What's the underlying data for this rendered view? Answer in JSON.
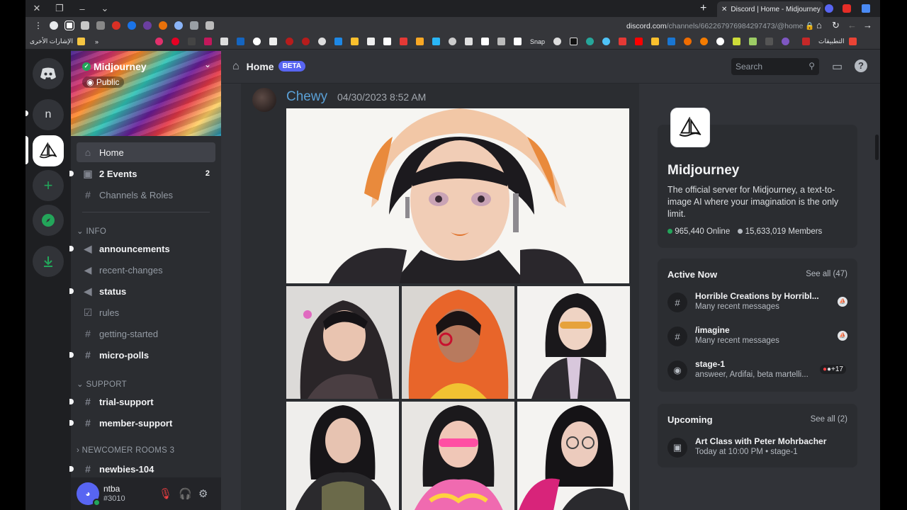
{
  "browser": {
    "tab_title": "Discord | Home - Midjourney",
    "url_host": "discord.com",
    "url_path": "/channels/662267976984297473/@home",
    "bookmarks_other": "الإشارات الأخرى",
    "bookmarks_apps": "التطبيقات",
    "bookmark_snap": "Snap",
    "new_tab_glyph": "+",
    "close_glyph": "✕"
  },
  "rail": {
    "dm_icon": "discord-logo-icon",
    "server_n_label": "n",
    "add_glyph": "+",
    "explore_icon": "compass-icon",
    "download_icon": "download-icon"
  },
  "server": {
    "name": "Midjourney",
    "badge": "Public",
    "home": "Home",
    "events_label": "2 Events",
    "events_count": "2",
    "channels_roles": "Channels & Roles",
    "cat_info": "INFO",
    "cat_support": "SUPPORT",
    "cat_newcomer": "NEWCOMER ROOMS 3",
    "channels": {
      "announcements": "announcements",
      "recent_changes": "recent-changes",
      "status": "status",
      "rules": "rules",
      "getting_started": "getting-started",
      "micro_polls": "micro-polls",
      "trial_support": "trial-support",
      "member_support": "member-support",
      "newbies": "newbies-104"
    }
  },
  "user": {
    "name": "ntba",
    "tag": "#3010"
  },
  "header": {
    "title": "Home",
    "beta": "BETA",
    "search_placeholder": "Search"
  },
  "message": {
    "author": "Chewy",
    "timestamp": "04/30/2023 8:52 AM"
  },
  "about": {
    "name": "Midjourney",
    "description": "The official server for Midjourney, a text-to-image AI where your imagination is the only limit.",
    "online": "965,440 Online",
    "members": "15,633,019 Members"
  },
  "active_now": {
    "title": "Active Now",
    "see_all": "See all (47)",
    "items": [
      {
        "title": "Horrible Creations by Horribl...",
        "sub": "Many recent messages"
      },
      {
        "title": "/imagine",
        "sub": "Many recent messages"
      },
      {
        "title": "stage-1",
        "sub": "answeer, Ardifai, beta martelli...",
        "extra": "+17"
      }
    ]
  },
  "upcoming": {
    "title": "Upcoming",
    "see_all": "See all (2)",
    "event_title": "Art Class with Peter Mohrbacher",
    "event_sub": "Today at 10:00 PM • stage-1"
  },
  "colors": {
    "accent": "#5865f2",
    "online": "#23a55a",
    "author": "#5aa0d6"
  }
}
